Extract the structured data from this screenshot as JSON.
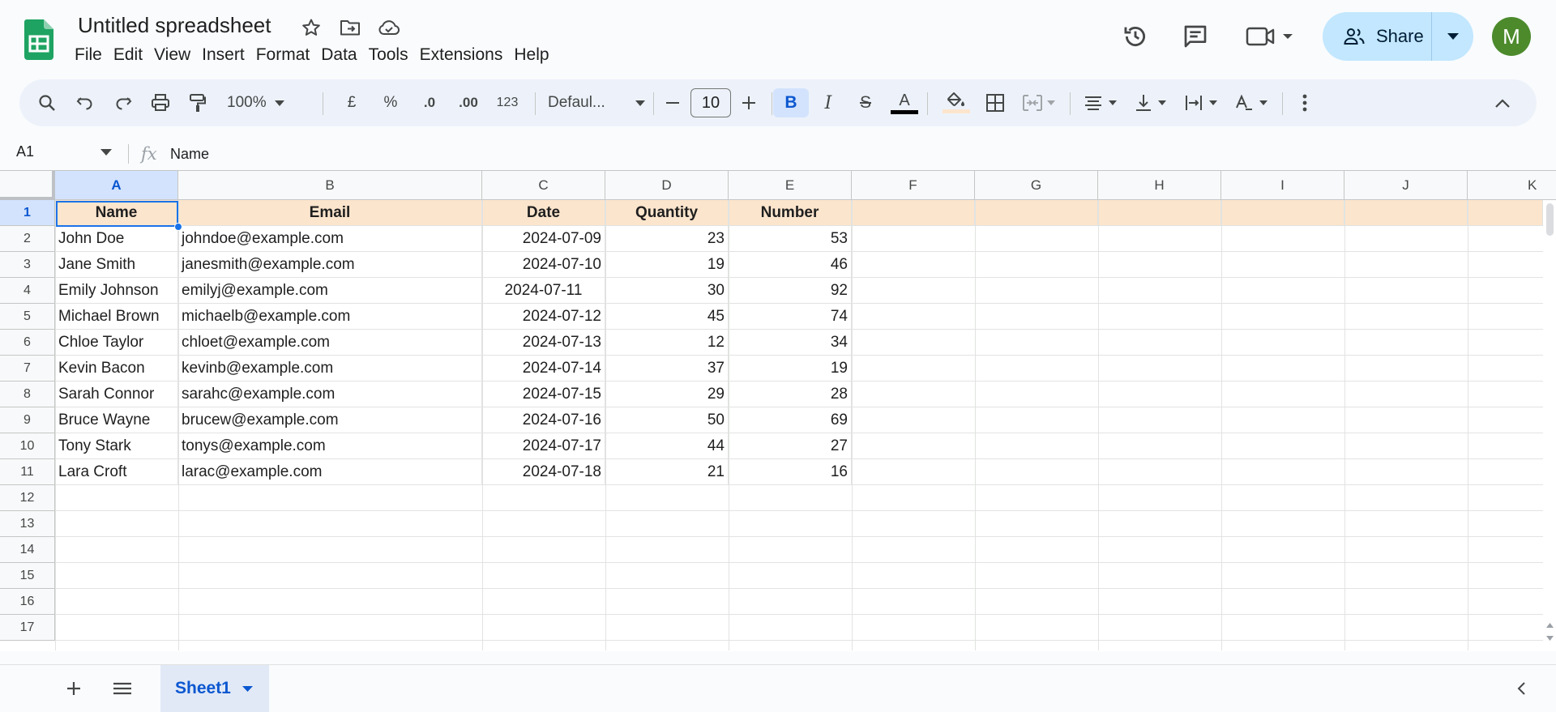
{
  "app": {
    "title": "Untitled spreadsheet",
    "menu": [
      "File",
      "Edit",
      "View",
      "Insert",
      "Format",
      "Data",
      "Tools",
      "Extensions",
      "Help"
    ],
    "share_label": "Share",
    "avatar_letter": "M"
  },
  "toolbar": {
    "zoom": "100%",
    "currency": "£",
    "percent": "%",
    "decrease_decimal": ".0",
    "increase_decimal": ".00",
    "number_format": "123",
    "font": "Defaul...",
    "font_size": "10",
    "bold": "B",
    "italic": "I",
    "strike": "S",
    "text_color_letter": "A"
  },
  "formula_bar": {
    "cell_ref": "A1",
    "fx": "fx",
    "content": "Name"
  },
  "grid": {
    "columns": [
      "A",
      "B",
      "C",
      "D",
      "E",
      "F",
      "G",
      "H",
      "I",
      "J",
      "K"
    ],
    "row_numbers": [
      "1",
      "2",
      "3",
      "4",
      "5",
      "6",
      "7",
      "8",
      "9",
      "10",
      "11",
      "12",
      "13",
      "14",
      "15",
      "16",
      "17"
    ],
    "header": [
      "Name",
      "Email",
      "Date",
      "Quantity",
      "Number"
    ],
    "rows": [
      [
        "John Doe",
        "johndoe@example.com",
        "2024-07-09",
        "23",
        "53"
      ],
      [
        "Jane Smith",
        "janesmith@example.com",
        "2024-07-10",
        "19",
        "46"
      ],
      [
        "Emily Johnson",
        "emilyj@example.com",
        "2024-07-11",
        "30",
        "92"
      ],
      [
        "Michael Brown",
        "michaelb@example.com",
        "2024-07-12",
        "45",
        "74"
      ],
      [
        "Chloe Taylor",
        "chloet@example.com",
        "2024-07-13",
        "12",
        "34"
      ],
      [
        "Kevin Bacon",
        "kevinb@example.com",
        "2024-07-14",
        "37",
        "19"
      ],
      [
        "Sarah Connor",
        "sarahc@example.com",
        "2024-07-15",
        "29",
        "28"
      ],
      [
        "Bruce Wayne",
        "brucew@example.com",
        "2024-07-16",
        "50",
        "69"
      ],
      [
        "Tony Stark",
        "tonys@example.com",
        "2024-07-17",
        "44",
        "27"
      ],
      [
        "Lara Croft",
        "larac@example.com",
        "2024-07-18",
        "21",
        "16"
      ]
    ]
  },
  "sheets": {
    "active": "Sheet1"
  },
  "colors": {
    "header_fill": "#fce5cd",
    "selection": "#1a73e8",
    "share_bg": "#c2e7ff",
    "avatar_bg": "#4c8a2c"
  }
}
